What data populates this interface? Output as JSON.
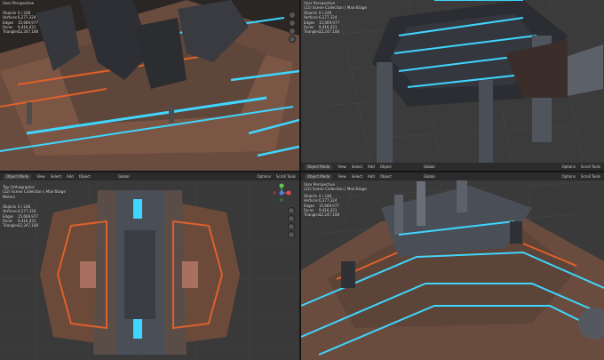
{
  "viewports": {
    "top_left": {
      "title": "User Perspective",
      "collection": "(22) Scene Collection | MainStage",
      "stats": [
        {
          "k": "Objects",
          "v": "0 / 248"
        },
        {
          "k": "Vertices",
          "v": "6,277,324"
        },
        {
          "k": "Edges",
          "v": "15,669,977"
        },
        {
          "k": "Faces",
          "v": "9,416,431"
        },
        {
          "k": "Triangles",
          "v": "12,247,108"
        }
      ]
    },
    "top_right": {
      "title": "User Perspective",
      "collection": "(22) Scene Collection | MainStage",
      "stats": [
        {
          "k": "Objects",
          "v": "0 / 248"
        },
        {
          "k": "Vertices",
          "v": "6,277,324"
        },
        {
          "k": "Edges",
          "v": "15,669,977"
        },
        {
          "k": "Faces",
          "v": "9,416,431"
        },
        {
          "k": "Triangles",
          "v": "12,247,108"
        }
      ],
      "header": {
        "mode": "Object Mode",
        "menus": [
          "View",
          "Select",
          "Add",
          "Object"
        ],
        "transform": "Global",
        "right": [
          "Options",
          "Scroll Tools"
        ]
      }
    },
    "bottom_left": {
      "title": "Top Orthographic",
      "collection": "(22) Scene Collection | MainStage",
      "units": "Meters",
      "stats": [
        {
          "k": "Objects",
          "v": "0 / 248"
        },
        {
          "k": "Vertices",
          "v": "6,277,324"
        },
        {
          "k": "Edges",
          "v": "15,669,977"
        },
        {
          "k": "Faces",
          "v": "9,416,431"
        },
        {
          "k": "Triangles",
          "v": "12,247,108"
        }
      ],
      "header": {
        "mode": "Object Mode",
        "menus": [
          "View",
          "Select",
          "Add",
          "Object"
        ],
        "transform": "Global",
        "right": [
          "Options",
          "Scroll Tools"
        ]
      }
    },
    "bottom_right": {
      "title": "User Perspective",
      "collection": "(22) Scene Collection | MainStage",
      "stats": [
        {
          "k": "Objects",
          "v": "0 / 248"
        },
        {
          "k": "Vertices",
          "v": "6,277,324"
        },
        {
          "k": "Edges",
          "v": "15,669,977"
        },
        {
          "k": "Faces",
          "v": "9,416,431"
        },
        {
          "k": "Triangles",
          "v": "12,247,108"
        }
      ],
      "header": {
        "mode": "Object Mode",
        "menus": [
          "View",
          "Select",
          "Add",
          "Object"
        ],
        "transform": "Global",
        "right": [
          "Options",
          "Scroll Tools"
        ]
      }
    }
  },
  "colors": {
    "neon": "#3fd6ff",
    "orange": "#e0602a",
    "rust": "#6b4a3a",
    "metal": "#4a4f57",
    "grid": "#444444"
  }
}
